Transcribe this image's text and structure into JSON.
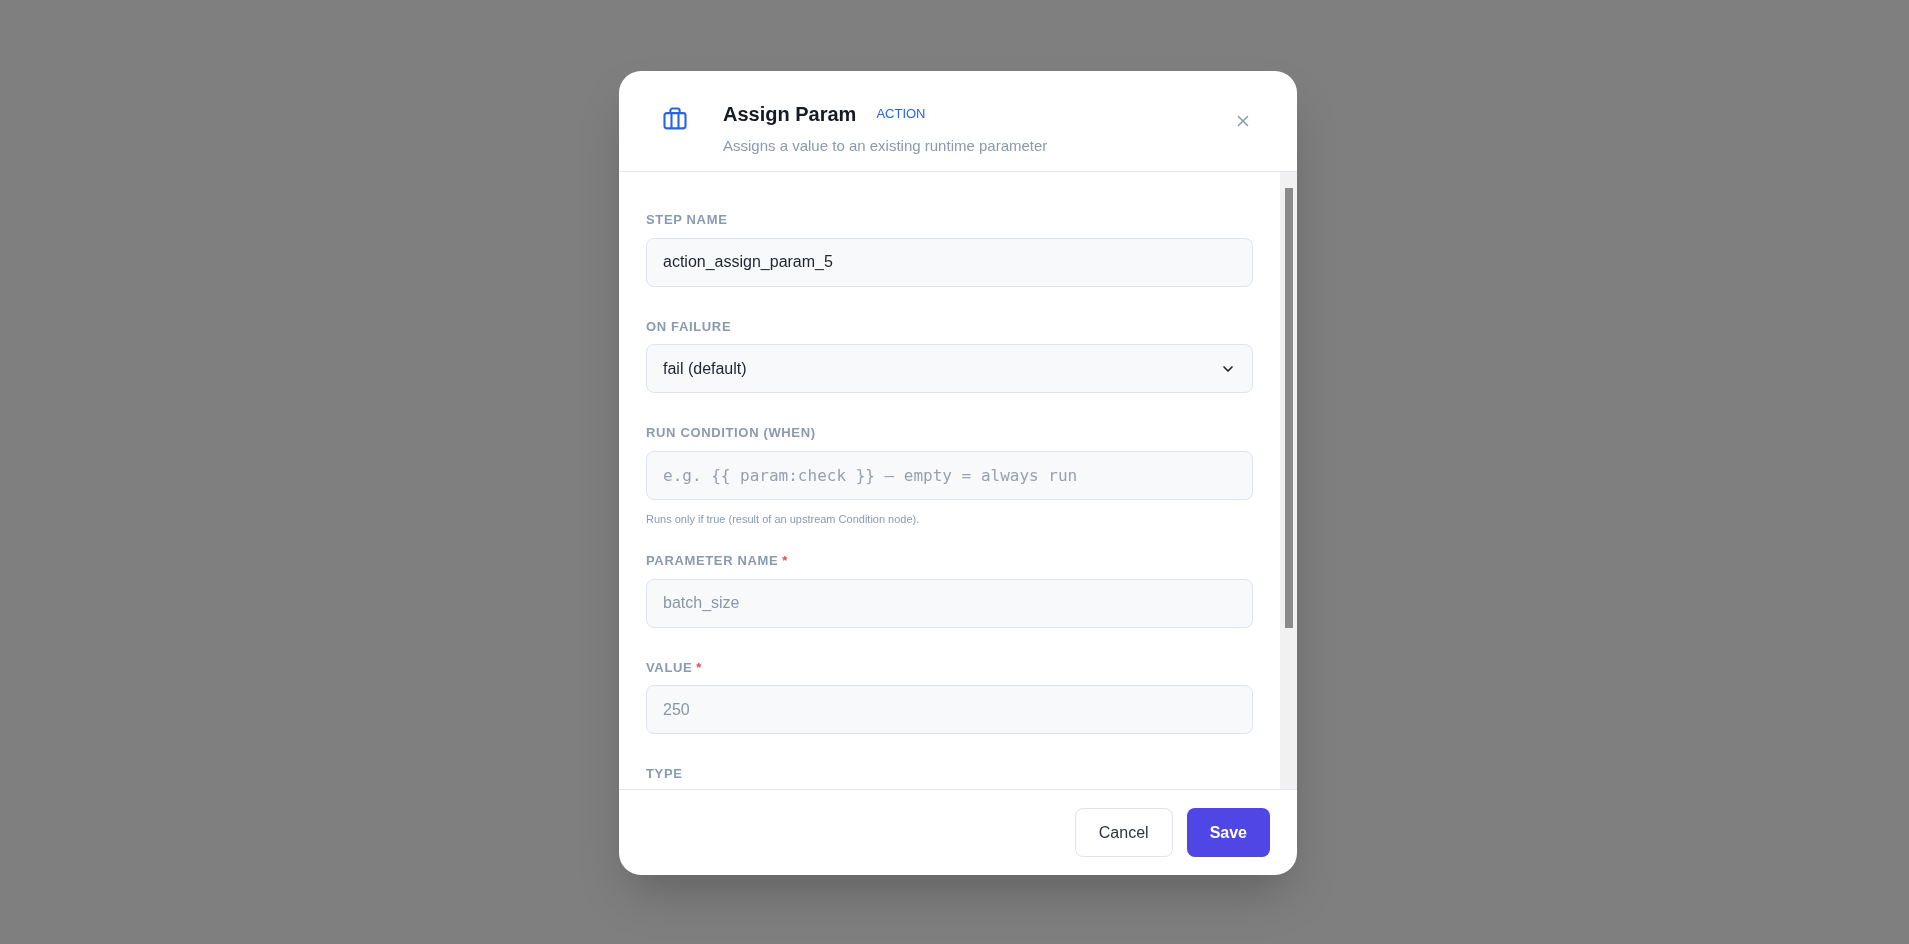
{
  "dialog": {
    "title": "Assign Param",
    "badge": "ACTION",
    "subtitle": "Assigns a value to an existing runtime parameter",
    "fields": [
      {
        "kind": "text",
        "label": "STEP NAME",
        "value": "action_assign_param_5"
      },
      {
        "kind": "select",
        "label": "ON FAILURE",
        "value": "fail (default)"
      },
      {
        "kind": "code",
        "label": "RUN CONDITION (WHEN)",
        "placeholder": "e.g. {{ param:check }} — empty = always run",
        "hint": "Runs only if true (result of an upstream Condition node)."
      },
      {
        "kind": "text",
        "label": "PARAMETER NAME",
        "required_mark": "*",
        "placeholder": "batch_size"
      },
      {
        "kind": "text",
        "label": "VALUE",
        "required_mark": "*",
        "placeholder": "250"
      },
      {
        "kind": "label",
        "label": "TYPE"
      }
    ],
    "buttons": [
      {
        "label": "Cancel",
        "kind": "secondary"
      },
      {
        "label": "Save",
        "kind": "primary"
      }
    ]
  }
}
